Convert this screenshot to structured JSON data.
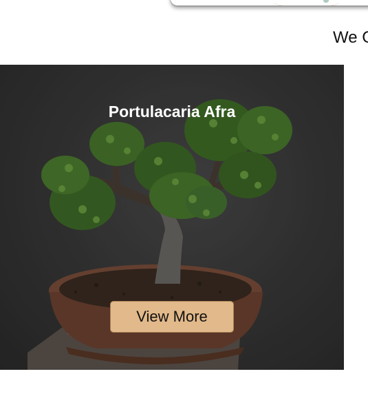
{
  "top_partial_heading": "We C",
  "product": {
    "title": "Portulacaria Afra",
    "button_label": "View More",
    "image_subject": "portulacaria-afra-bonsai-image"
  },
  "colors": {
    "button_bg": "#e2b98a",
    "card_bg": "#3a3a3a",
    "title_text": "#ffffff"
  }
}
